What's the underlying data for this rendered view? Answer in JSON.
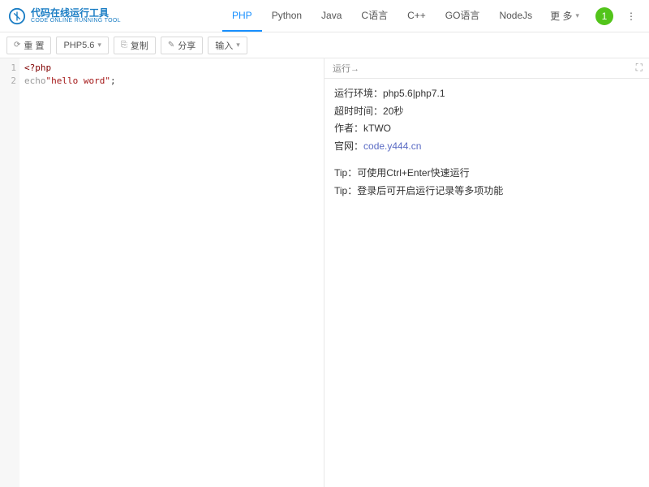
{
  "header": {
    "logo_cn": "代码在线运行工具",
    "logo_en": "CODE ONLINE RUNNING TOOL",
    "tabs": [
      "PHP",
      "Python",
      "Java",
      "C语言",
      "C++",
      "GO语言",
      "NodeJs"
    ],
    "active_tab": 0,
    "more_label": "更 多",
    "avatar_text": "1"
  },
  "toolbar": {
    "reset_label": "重 置",
    "version_label": "PHP5.6",
    "copy_label": "复制",
    "share_label": "分享",
    "input_label": "输入"
  },
  "editor": {
    "line_numbers": [
      "1",
      "2"
    ],
    "code_lines": [
      {
        "type": "php_open",
        "text": "<?php"
      },
      {
        "type": "echo",
        "keyword": "echo",
        "string": "\"hello word\"",
        "tail": ";"
      }
    ]
  },
  "output": {
    "run_label": "运行→",
    "info": {
      "env_label": "运行环境：",
      "env_value": "php5.6|php7.1",
      "timeout_label": "超时时间：",
      "timeout_value": "20秒",
      "author_label": "作者：",
      "author_value": "kTWO",
      "site_label": "官网：",
      "site_value": "code.y444.cn"
    },
    "tips": [
      "Tip：可使用Ctrl+Enter快速运行",
      "Tip：登录后可开启运行记录等多项功能"
    ]
  }
}
